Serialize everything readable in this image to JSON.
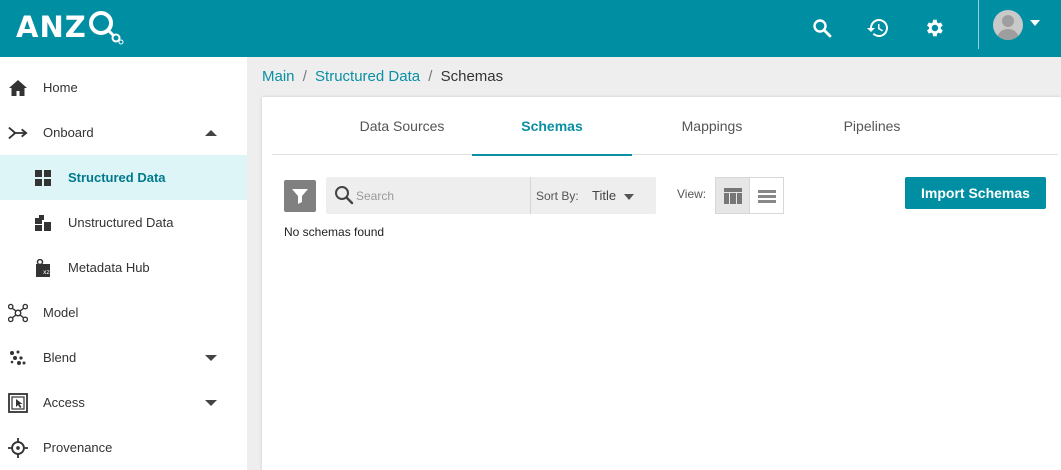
{
  "brand": {
    "logo_text": "ANZ",
    "accent_color": "#008ea3",
    "active_bg": "#def5f7"
  },
  "topbar": {
    "icons": [
      "search-icon",
      "history-icon",
      "gear-icon",
      "avatar"
    ]
  },
  "sidebar": {
    "items": [
      {
        "label": "Home",
        "icon": "home-icon"
      },
      {
        "label": "Onboard",
        "icon": "onboard-arrow-icon",
        "expanded": true
      },
      {
        "label": "Structured Data",
        "icon": "grid-icon",
        "active": true
      },
      {
        "label": "Unstructured Data",
        "icon": "blocks-icon"
      },
      {
        "label": "Metadata Hub",
        "icon": "metadata-icon"
      },
      {
        "label": "Model",
        "icon": "model-graph-icon"
      },
      {
        "label": "Blend",
        "icon": "blend-dots-icon",
        "expanded": false
      },
      {
        "label": "Access",
        "icon": "access-icon",
        "expanded": false
      },
      {
        "label": "Provenance",
        "icon": "crosshair-icon"
      }
    ]
  },
  "breadcrumb": {
    "main": "Main",
    "separator": "/",
    "structured": "Structured Data",
    "current": "Schemas"
  },
  "tabs": [
    {
      "label": "Data Sources"
    },
    {
      "label": "Schemas",
      "active": true
    },
    {
      "label": "Mappings"
    },
    {
      "label": "Pipelines"
    }
  ],
  "toolbar": {
    "search_placeholder": "Search",
    "search_value": "",
    "sort_label": "Sort By:",
    "sort_value": "Title",
    "view_label": "View:",
    "view_mode": "grid",
    "import_label": "Import Schemas"
  },
  "content": {
    "empty_message": "No schemas found"
  }
}
